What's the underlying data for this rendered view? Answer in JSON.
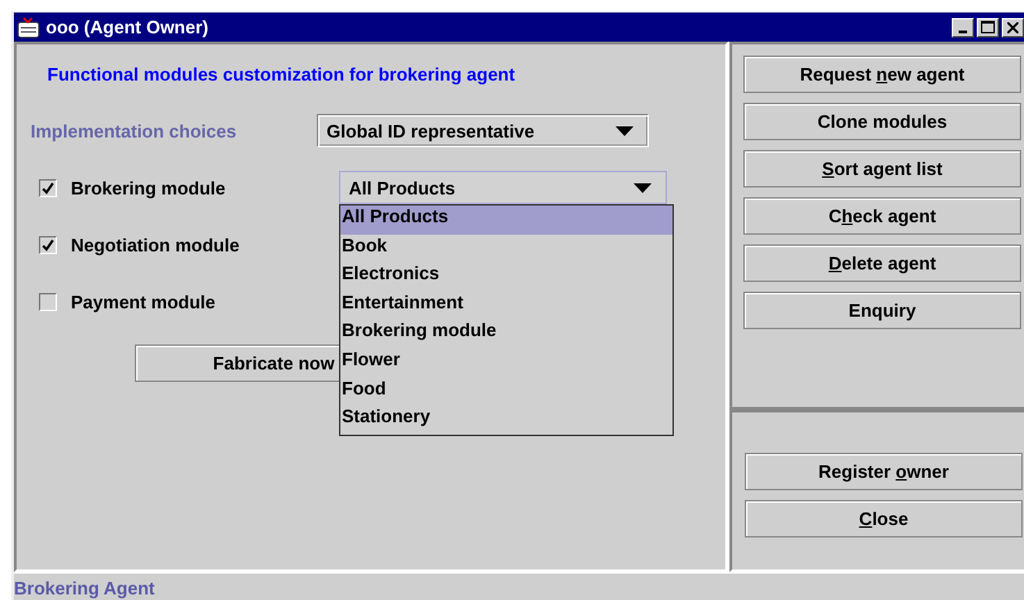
{
  "window": {
    "title": "ooo (Agent Owner)"
  },
  "heading": "Functional modules customization for brokering agent",
  "implementation": {
    "label": "Implementation choices",
    "value": "Global ID representative"
  },
  "modules": [
    {
      "label": "Brokering module",
      "checked": true
    },
    {
      "label": "Negotiation module",
      "checked": true
    },
    {
      "label": "Payment module",
      "checked": false
    }
  ],
  "product_combo": {
    "value": "All Products",
    "expanded": true,
    "options": [
      {
        "label": "All Products",
        "selected": true
      },
      {
        "label": "Book",
        "selected": false
      },
      {
        "label": "Electronics",
        "selected": false
      },
      {
        "label": "Entertainment",
        "selected": false
      },
      {
        "label": "Brokering module",
        "selected": false
      },
      {
        "label": "Flower",
        "selected": false
      },
      {
        "label": "Food",
        "selected": false
      },
      {
        "label": "Stationery",
        "selected": false
      }
    ]
  },
  "fabricate_button": {
    "label": "Fabricate now"
  },
  "side_buttons": [
    {
      "text_before": "Request ",
      "mnemonic": "n",
      "text_after": "ew agent"
    },
    {
      "text_before": "Clone modules"
    },
    {
      "mnemonic": "S",
      "text_after": "ort agent list"
    },
    {
      "text_before": "C",
      "mnemonic": "h",
      "text_after": "eck agent"
    },
    {
      "mnemonic": "D",
      "text_after": "elete agent"
    },
    {
      "text_before": "Enquiry"
    }
  ],
  "bottom_buttons": [
    {
      "text_before": "Register ",
      "mnemonic": "o",
      "text_after": "wner"
    },
    {
      "mnemonic": "C",
      "text_after": "lose"
    }
  ],
  "status_bar": "Brokering Agent"
}
